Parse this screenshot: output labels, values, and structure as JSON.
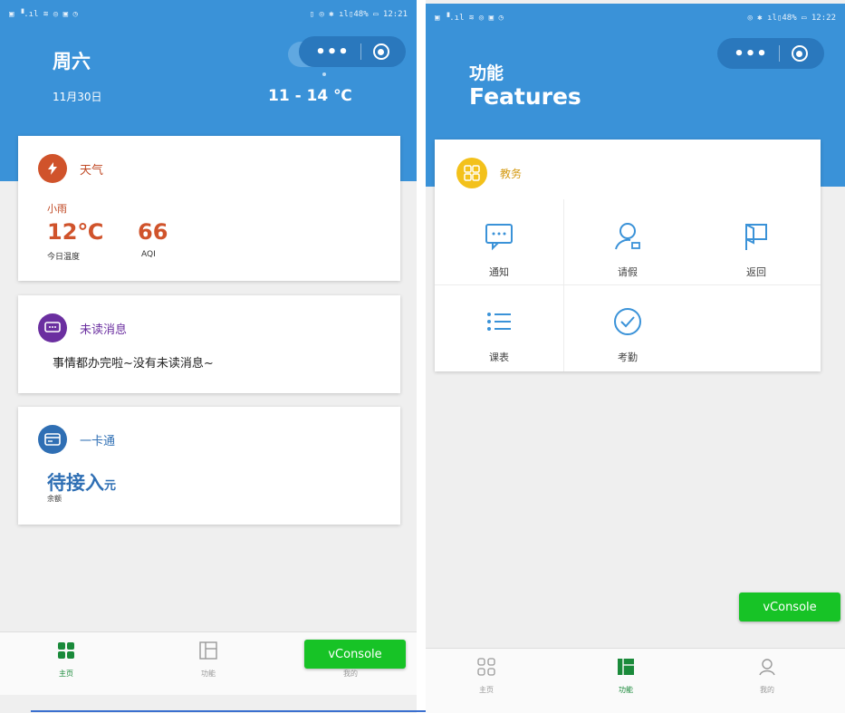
{
  "left": {
    "status": {
      "left": "▣ ▝.ıl ≋ ◎ ▣ ◷",
      "right": "▯ ◎ ✱ ıl▯48% ▭ 12:21"
    },
    "header": {
      "weekday": "周六",
      "date": "11月30日",
      "temp_range": "11 - 14 ℃"
    },
    "weather": {
      "title": "天气",
      "condition": "小雨",
      "temp": "12℃",
      "temp_label": "今日温度",
      "aqi": "66",
      "aqi_label": "AQI"
    },
    "unread": {
      "title": "未读消息",
      "text": "事情都办完啦~没有未读消息~"
    },
    "ecard": {
      "title": "一卡通",
      "value": "待接入",
      "unit": "元",
      "label": "余额"
    },
    "tabs": [
      {
        "label": "主页"
      },
      {
        "label": "功能"
      },
      {
        "label": "我的"
      }
    ],
    "vconsole": "vConsole"
  },
  "right": {
    "status": {
      "left": "▣ ▝.ıl ≋ ◎ ▣ ◷",
      "right": "◎ ✱ ıl▯48% ▭ 12:22"
    },
    "header": {
      "title_cn": "功能",
      "title_en": "Features"
    },
    "section": {
      "title": "教务"
    },
    "features": [
      {
        "label": "通知"
      },
      {
        "label": "请假"
      },
      {
        "label": "返回"
      },
      {
        "label": "课表"
      },
      {
        "label": "考勤"
      }
    ],
    "tabs": [
      {
        "label": "主页"
      },
      {
        "label": "功能"
      },
      {
        "label": "我的"
      }
    ],
    "vconsole": "vConsole"
  },
  "colors": {
    "header_blue": "#3a92d8",
    "weather_red": "#d0532b",
    "purple": "#6b2fa0",
    "ecard_blue": "#2f6fb4",
    "yellow": "#f3c11b",
    "vconsole_green": "#17c326"
  }
}
